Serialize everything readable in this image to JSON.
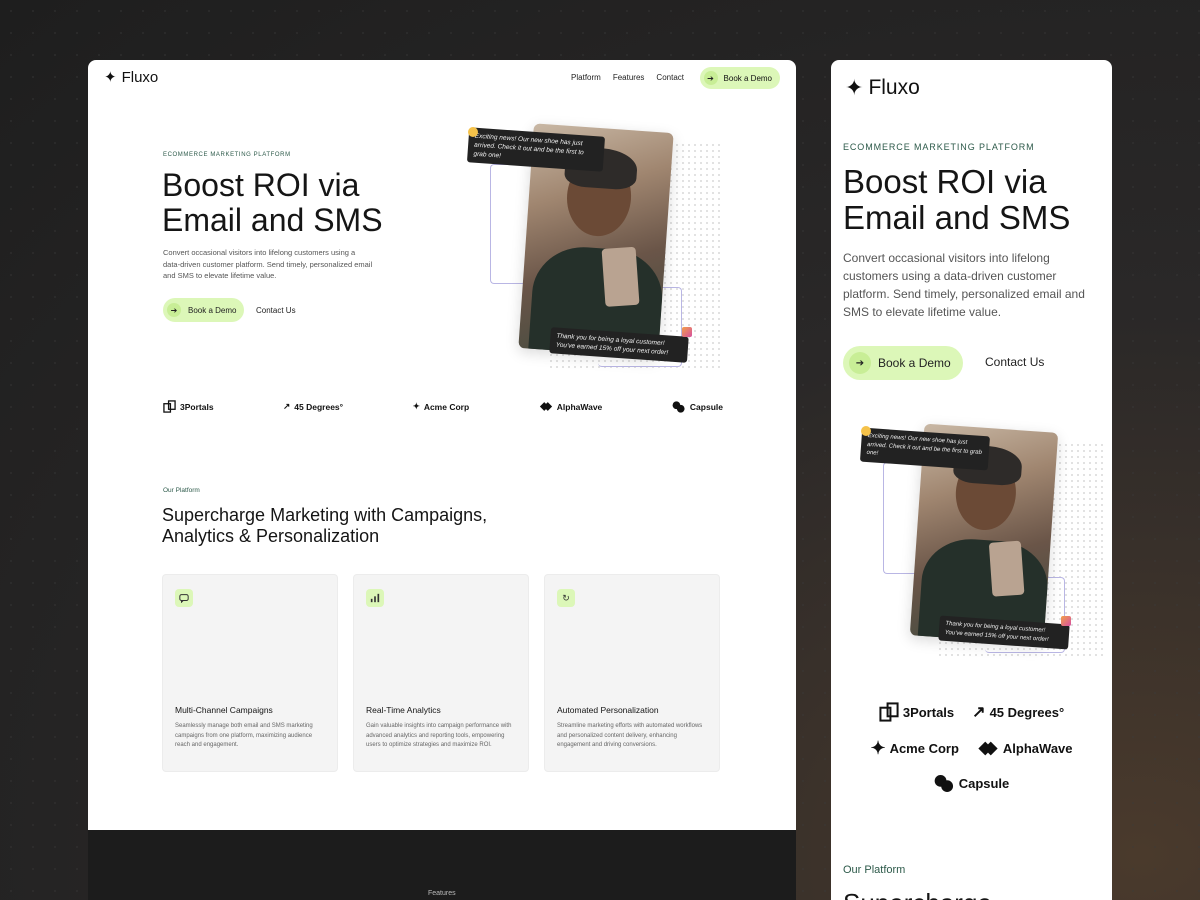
{
  "brand": {
    "name": "Fluxo"
  },
  "nav": {
    "links": [
      "Platform",
      "Features",
      "Contact"
    ],
    "cta": "Book a Demo"
  },
  "hero": {
    "eyebrow": "ECOMMERCE MARKETING PLATFORM",
    "title_line1": "Boost ROI via",
    "title_line2": "Email and SMS",
    "subtitle": "Convert occasional visitors into lifelong customers using a data-driven customer platform. Send timely, personalized email and SMS to elevate lifetime value.",
    "primary_button": "Book a Demo",
    "secondary_button": "Contact Us",
    "bubble_top": "Exciting news! Our new shoe has just arrived. Check it out and be the first to grab one!",
    "bubble_bottom": "Thank you for being a loyal customer! You've earned 15% off your next order!"
  },
  "logos": [
    "3Portals",
    "45 Degrees°",
    "Acme Corp",
    "AlphaWave",
    "Capsule"
  ],
  "platform": {
    "eyebrow": "Our Platform",
    "title_line1": "Supercharge Marketing with Campaigns,",
    "title_line2": "Analytics & Personalization",
    "cards": [
      {
        "icon": "chat-icon",
        "title": "Multi-Channel Campaigns",
        "desc": "Seamlessly manage both email and SMS marketing campaigns from one platform, maximizing audience reach and engagement."
      },
      {
        "icon": "bar-chart-icon",
        "title": "Real-Time Analytics",
        "desc": "Gain valuable insights into campaign performance with advanced analytics and reporting tools, empowering users to optimize strategies and maximize ROI."
      },
      {
        "icon": "refresh-icon",
        "title": "Automated Personalization",
        "desc": "Streamline marketing efforts with automated workflows and personalized content delivery, enhancing engagement and driving conversions."
      }
    ]
  },
  "footer": {
    "label": "Features"
  },
  "mobile": {
    "platform_eyebrow": "Our Platform",
    "platform_title_peek": "Supercharge"
  },
  "colors": {
    "accent": "#dcf7b8",
    "accent_dark": "#c8ee96",
    "eyebrow": "#2d5a4a",
    "dark_band": "#1c1c1c"
  }
}
